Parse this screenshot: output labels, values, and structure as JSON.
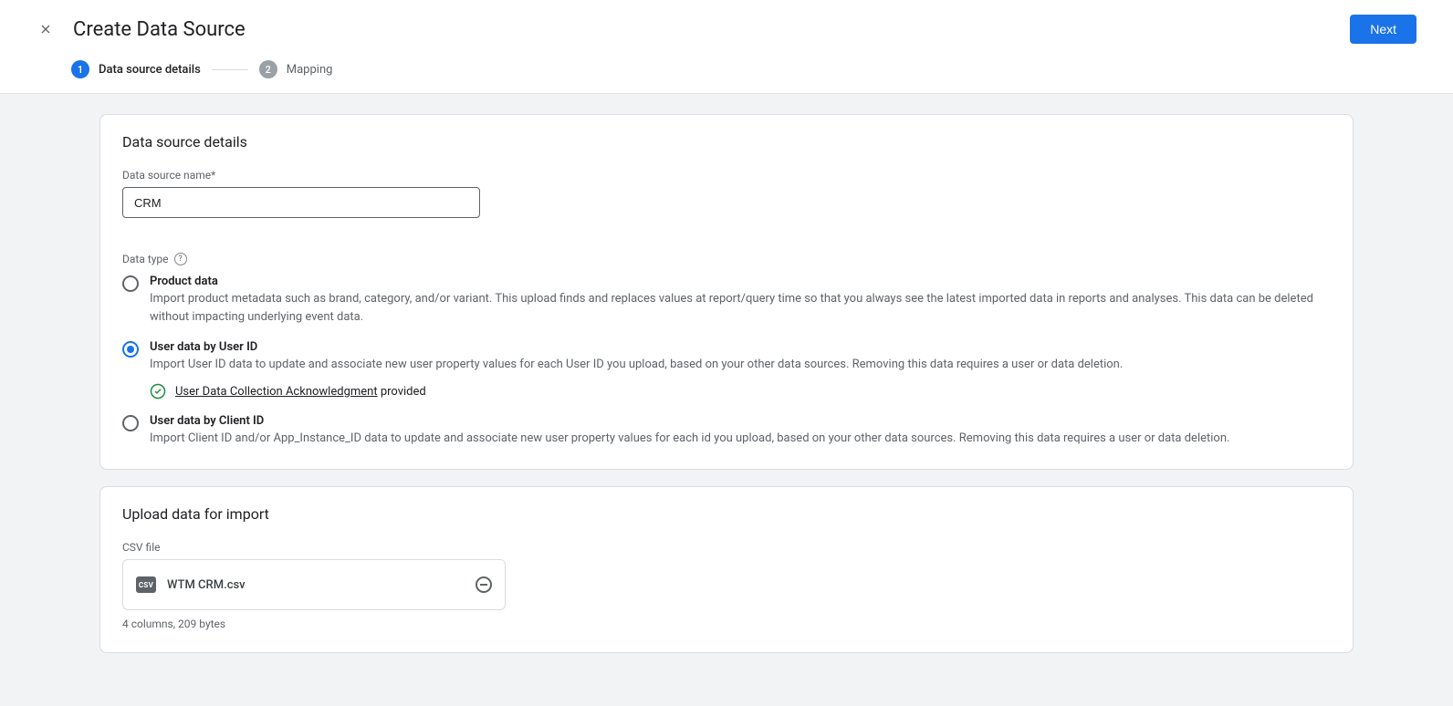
{
  "header": {
    "title": "Create Data Source",
    "next_label": "Next"
  },
  "stepper": {
    "step1": {
      "num": "1",
      "label": "Data source details"
    },
    "step2": {
      "num": "2",
      "label": "Mapping"
    }
  },
  "details_card": {
    "title": "Data source details",
    "name_label": "Data source name*",
    "name_value": "CRM",
    "data_type_label": "Data type",
    "options": {
      "product": {
        "title": "Product data",
        "desc": "Import product metadata such as brand, category, and/or variant. This upload finds and replaces values at report/query time so that you always see the latest imported data in reports and analyses. This data can be deleted without impacting underlying event data."
      },
      "user_id": {
        "title": "User data by User ID",
        "desc": "Import User ID data to update and associate new user property values for each User ID you upload, based on your other data sources. Removing this data requires a user or data deletion.",
        "ack_link": "User Data Collection Acknowledgment",
        "ack_suffix": " provided"
      },
      "client_id": {
        "title": "User data by Client ID",
        "desc": "Import Client ID and/or App_Instance_ID data to update and associate new user property values for each id you upload, based on your other data sources. Removing this data requires a user or data deletion."
      }
    }
  },
  "upload_card": {
    "title": "Upload data for import",
    "csv_label": "CSV file",
    "csv_badge": "CSV",
    "file_name": "WTM CRM.csv",
    "file_meta": "4 columns, 209 bytes"
  }
}
